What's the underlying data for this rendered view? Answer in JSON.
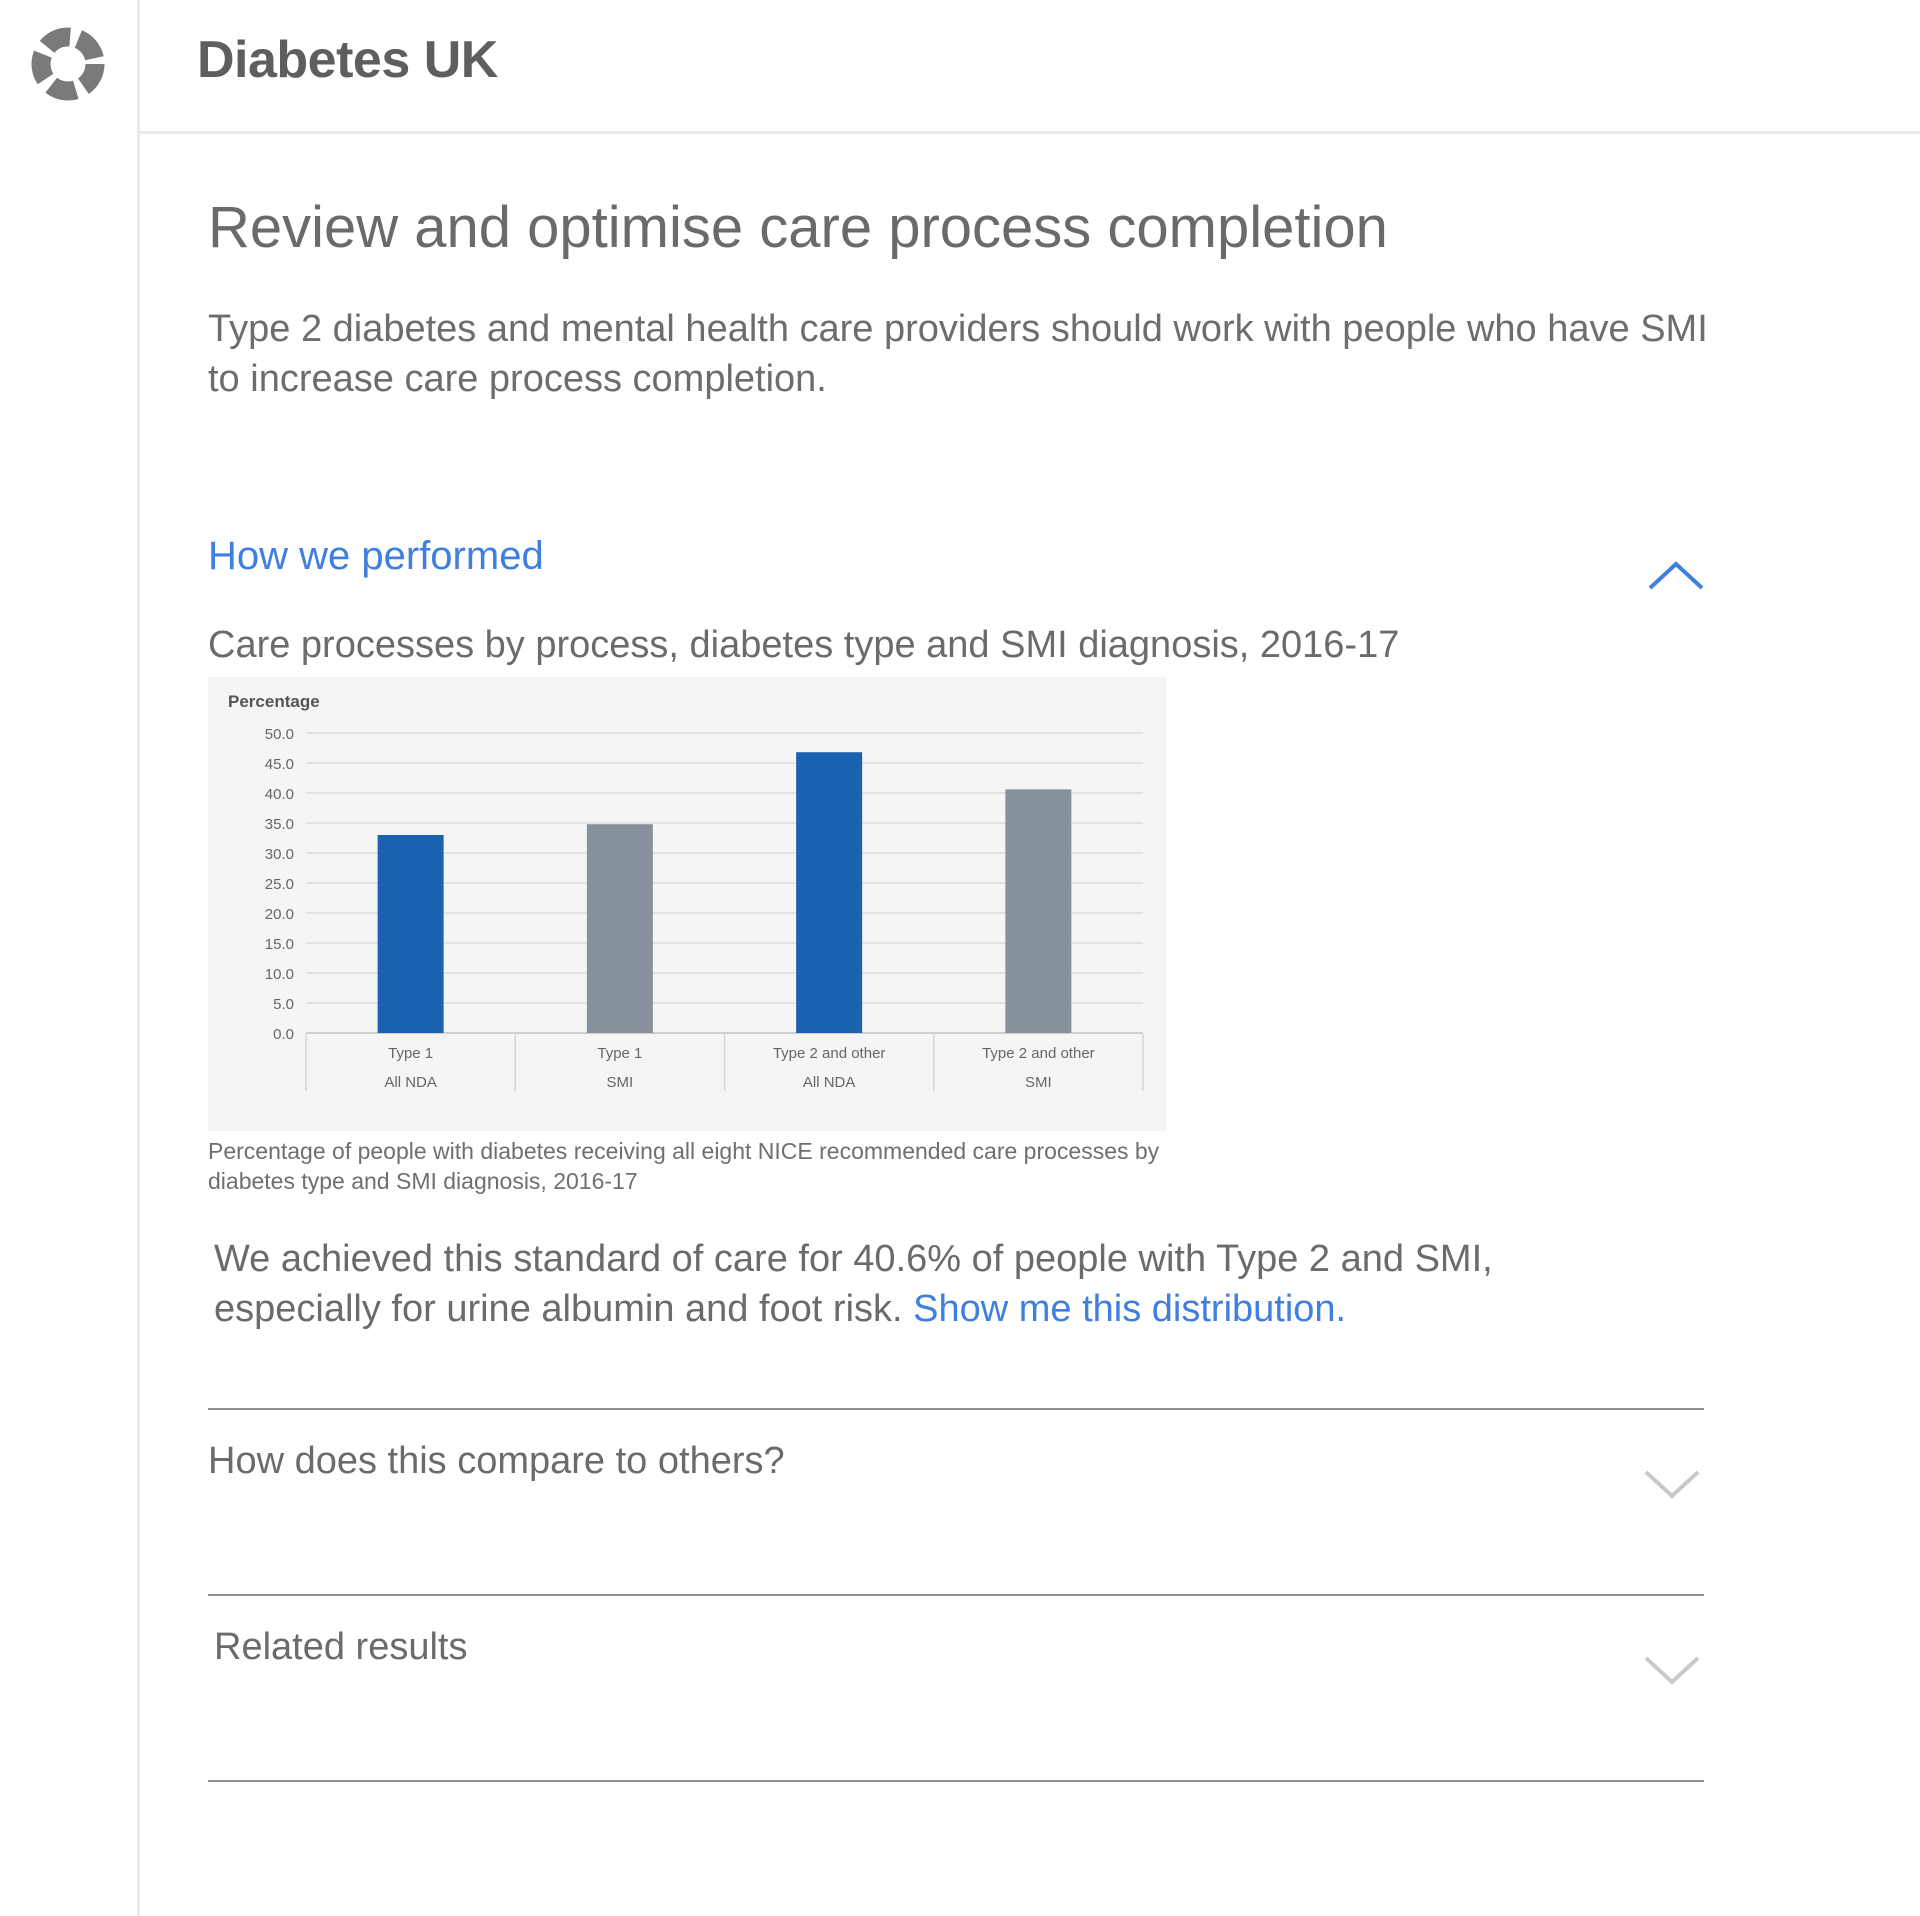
{
  "app": {
    "brand": "Diabetes UK",
    "logo_icon": "ring-logo-icon"
  },
  "page": {
    "title": "Review and optimise care process completion",
    "intro": "Type 2 diabetes and mental health care providers should work with people who have SMI to increase care process completion."
  },
  "performance": {
    "heading": "How we performed",
    "expanded": true,
    "chevron_icon": "chevron-up-icon",
    "chart_title": "Care processes by process, diabetes type and SMI diagnosis, 2016-17",
    "chart_caption": "Percentage of people with diabetes receiving all eight NICE recommended care processes by diabetes type and SMI diagnosis, 2016-17",
    "summary_text": "We achieved this standard of care for 40.6% of people with Type 2 and SMI, especially for urine albumin and foot risk. ",
    "summary_link": "Show me this distribution."
  },
  "accordions": [
    {
      "label": "How does this compare to others?",
      "expanded": false,
      "chevron_icon": "chevron-down-icon"
    },
    {
      "label": "Related results",
      "expanded": false,
      "chevron_icon": "chevron-down-icon"
    }
  ],
  "colors": {
    "accent": "#3f7fe0",
    "bar_all_nda": "#1b63b0",
    "bar_smi": "#87919b"
  },
  "chart_data": {
    "type": "bar",
    "title": "",
    "ylabel": "Percentage",
    "xlabel": "",
    "ylim": [
      0,
      50
    ],
    "yticks": [
      "0.0",
      "5.0",
      "10.0",
      "15.0",
      "20.0",
      "25.0",
      "30.0",
      "35.0",
      "40.0",
      "45.0",
      "50.0"
    ],
    "grid": true,
    "categories": [
      {
        "line1": "Type 1",
        "line2": "All NDA"
      },
      {
        "line1": "Type 1",
        "line2": "SMI"
      },
      {
        "line1": "Type 2 and other",
        "line2": "All NDA"
      },
      {
        "line1": "Type 2 and other",
        "line2": "SMI"
      }
    ],
    "values": [
      33.0,
      34.8,
      46.8,
      40.6
    ],
    "bar_colors": [
      "#1b63b0",
      "#87919b",
      "#1b63b0",
      "#87919b"
    ]
  }
}
